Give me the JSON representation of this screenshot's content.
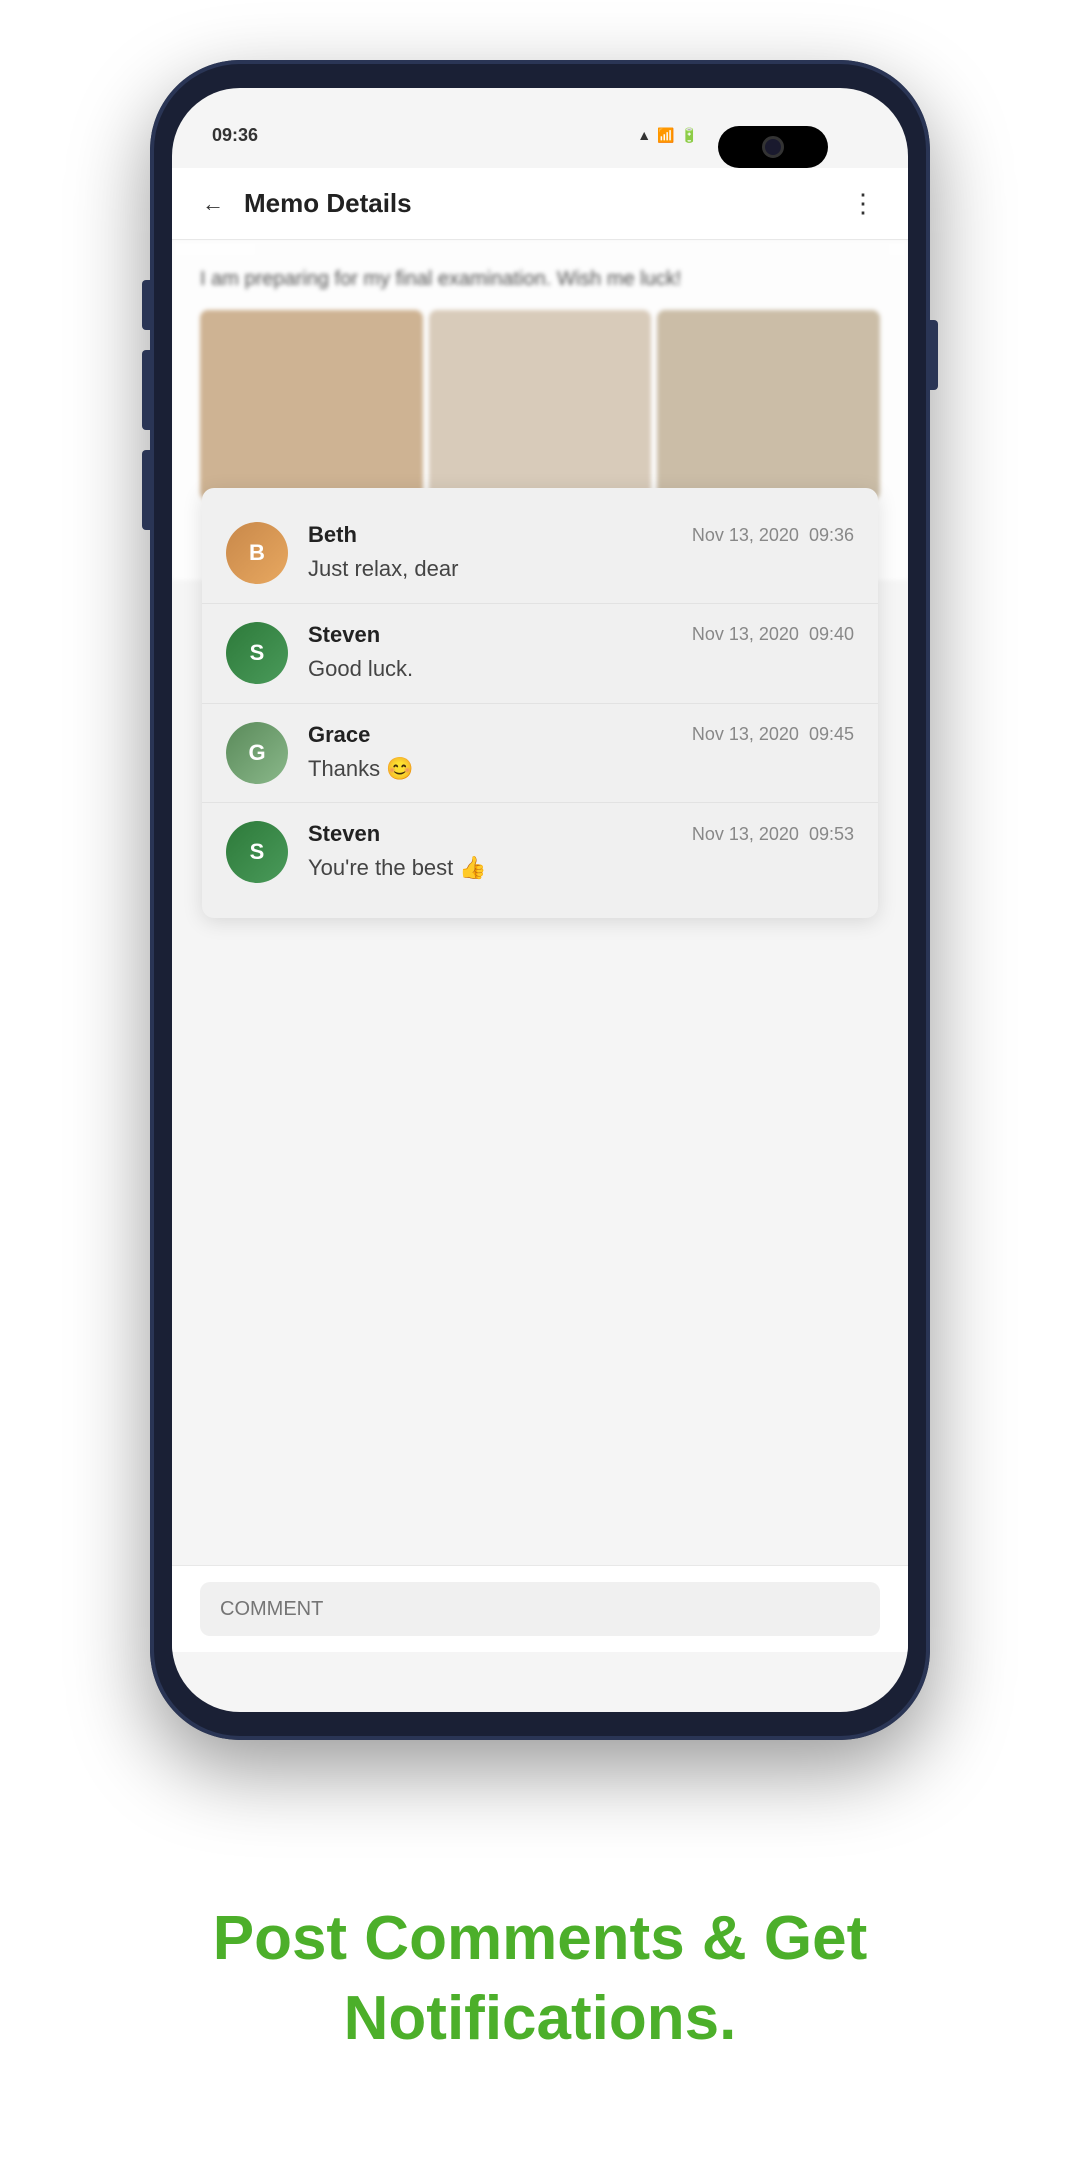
{
  "phone": {
    "status_time": "09:36",
    "status_icons": [
      "signal",
      "wifi",
      "battery"
    ]
  },
  "app_header": {
    "title": "Memo Details",
    "back_label": "←",
    "more_label": "⋮"
  },
  "post": {
    "text": "I am preparing for my final examination. Wish me luck!",
    "images": [
      "study1",
      "study2",
      "study3"
    ]
  },
  "comments": [
    {
      "author": "Beth",
      "date": "Nov 13, 2020",
      "time": "09:36",
      "text": "Just relax, dear",
      "avatar_type": "beth",
      "avatar_letter": "B"
    },
    {
      "author": "Steven",
      "date": "Nov 13, 2020",
      "time": "09:40",
      "text": "Good luck.",
      "avatar_type": "steven",
      "avatar_letter": "S"
    },
    {
      "author": "Grace",
      "date": "Nov 13, 2020",
      "time": "09:45",
      "text": "Thanks 😊",
      "avatar_type": "grace",
      "avatar_letter": "G"
    },
    {
      "author": "Steven",
      "date": "Nov 13, 2020",
      "time": "09:53",
      "text": "You're the best 👍",
      "avatar_type": "steven",
      "avatar_letter": "S"
    }
  ],
  "comment_input": {
    "placeholder": "COMMENT"
  },
  "tagline": {
    "line1": "Post Comments & Get",
    "line2": "Notifications."
  }
}
